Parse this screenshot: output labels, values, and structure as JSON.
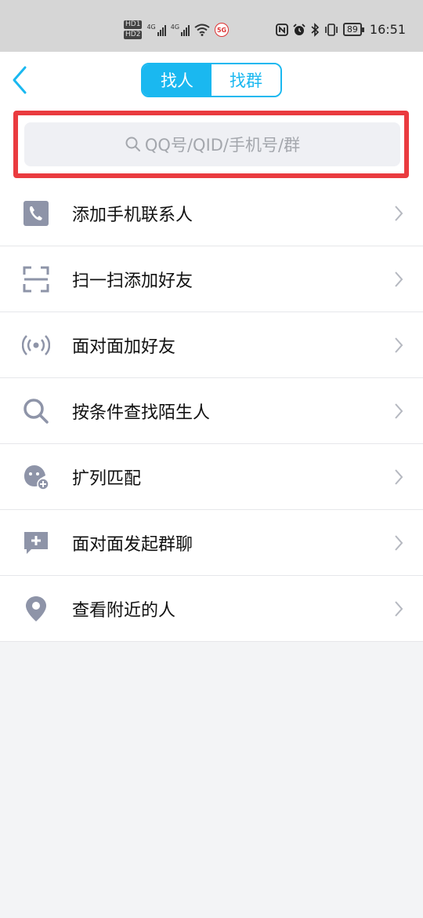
{
  "status_bar": {
    "hd1": "HD1",
    "hd2": "HD2",
    "net1": "4G",
    "net2": "4G",
    "badge5g": "5G",
    "battery": "89",
    "time": "16:51",
    "icons": [
      "nfc-icon",
      "alarm-icon",
      "bluetooth-icon",
      "vibrate-icon"
    ]
  },
  "header": {
    "back_icon": "chevron-left-icon",
    "tabs": [
      {
        "label": "找人",
        "active": true
      },
      {
        "label": "找群",
        "active": false
      }
    ]
  },
  "search": {
    "placeholder": "QQ号/QID/手机号/群",
    "icon": "search-icon"
  },
  "menu": [
    {
      "label": "添加手机联系人",
      "icon": "phone-contact-icon"
    },
    {
      "label": "扫一扫添加好友",
      "icon": "scan-icon"
    },
    {
      "label": "面对面加好友",
      "icon": "radar-icon"
    },
    {
      "label": "按条件查找陌生人",
      "icon": "search-icon"
    },
    {
      "label": "扩列匹配",
      "icon": "match-icon"
    },
    {
      "label": "面对面发起群聊",
      "icon": "chat-add-icon"
    },
    {
      "label": "查看附近的人",
      "icon": "location-pin-icon"
    }
  ],
  "colors": {
    "accent": "#1ab8f0",
    "highlight": "#ea3b3f",
    "icon_gray": "#8e94a8"
  }
}
